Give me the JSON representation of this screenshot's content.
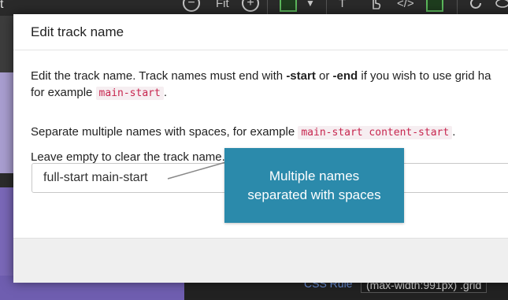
{
  "topbar": {
    "title_fragment": "t",
    "zoom_out_symbol": "−",
    "zoom_label": "Fit",
    "zoom_in_symbol": "+",
    "icons": [
      "zoom-out-icon",
      "zoom-in-icon",
      "grid-layout-icon",
      "chevron-down-icon",
      "text-size-icon",
      "hand-pointer-icon",
      "code-icon",
      "js-file-icon",
      "refresh-icon",
      "eye-icon"
    ]
  },
  "dialog": {
    "title": "Edit track name",
    "para1_a": "Edit the track name. Track names must end with ",
    "para1_start": "-start",
    "para1_or": " or ",
    "para1_end": "-end",
    "para1_b": " if you wish to use grid ha",
    "para2_a": "for example ",
    "para2_code": "main-start",
    "para2_b": ".",
    "para3_a": "Separate multiple names with spaces, for example ",
    "para3_code": "main-start content-start",
    "para3_b": ".",
    "para4": "Leave empty to clear the track name.",
    "input_value": "full-start main-start"
  },
  "callout": {
    "line1": "Multiple names",
    "line2": "separated with spaces",
    "color": "#2b8aab"
  },
  "background": {
    "css_rule_label": "CSS Rule",
    "css_rule_value": "(max-width:991px) .grid"
  }
}
